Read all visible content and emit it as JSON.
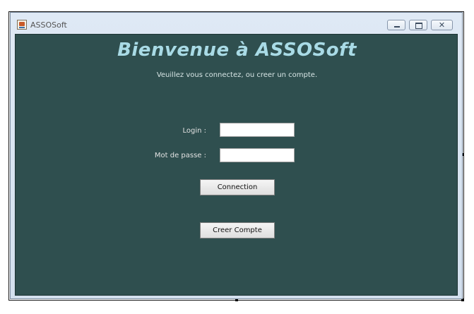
{
  "window": {
    "title": "ASSOSoft",
    "controls": {
      "minimize_icon": "minimize-icon",
      "maximize_icon": "maximize-icon",
      "close_icon": "close-icon",
      "close_glyph": "✕"
    }
  },
  "main": {
    "heading": "Bienvenue à ASSOSoft",
    "subtitle": "Veuillez vous connectez, ou creer un compte."
  },
  "form": {
    "login_label": "Login :",
    "login_value": "",
    "password_label": "Mot de passe :",
    "password_value": "",
    "connection_button": "Connection",
    "create_account_button": "Creer Compte"
  },
  "colors": {
    "panel_background": "#2f4f4f",
    "heading_color": "#a9dbe6",
    "label_color": "#e2e2e2"
  }
}
